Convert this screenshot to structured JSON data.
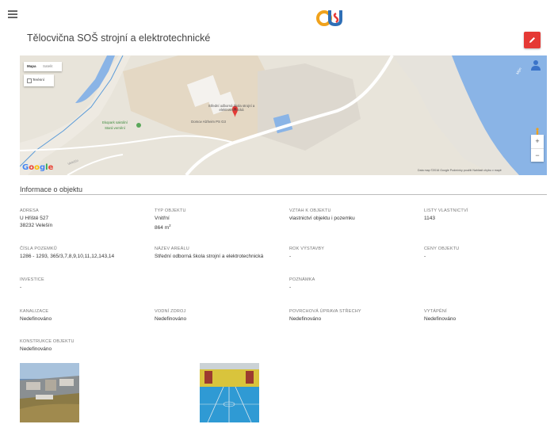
{
  "header": {
    "menu_icon": "hamburger-menu-icon",
    "logo_text": "CUS",
    "logo_colors": {
      "orange": "#f0a21c",
      "blue": "#2f6fb6",
      "red": "#e53935"
    }
  },
  "page": {
    "title": "Tělocvična SOŠ strojní a elektrotechnické",
    "edit_icon": "pencil-icon",
    "edit_color": "#e53935"
  },
  "map": {
    "type_map": "Mapa",
    "type_satellite": "Satelit",
    "terrain_label": "Terénní",
    "labels": [
      "Střední odborná škola strojní a elektrotechnická",
      "Domov Alzheim PS G3",
      "Ekopark sakrální",
      "Stará vernění",
      "Mlýn",
      "Velešín"
    ],
    "zoom_in": "+",
    "zoom_out": "−",
    "brand": "Google",
    "attribution": "Data map ©2016 Google   Podmínky použití   Nahlásit chybu v mapě"
  },
  "info": {
    "section_title": "Informace o objektu",
    "fields": {
      "adresa": {
        "label": "ADRESA",
        "lines": [
          "U Hřiště 527",
          "38232 Velešín"
        ]
      },
      "typ": {
        "label": "TYP OBJEKTU",
        "line1": "Vnitřní",
        "area_value": "864 m",
        "area_exp": "2"
      },
      "vztah": {
        "label": "VZTAH K OBJEKTU",
        "value": "vlastnictví objektu i pozemku"
      },
      "listy": {
        "label": "LISTY VLASTNICTVÍ",
        "value": "1143"
      },
      "cisla": {
        "label": "ČÍSLA POZEMKŮ",
        "value": "1286 - 1293, 365/3,7,8,9,10,11,12,143,14"
      },
      "nazev": {
        "label": "NÁZEV AREÁLU",
        "value": "Střední odborná škola strojní a elektrotechnická"
      },
      "rok": {
        "label": "ROK VÝSTAVBY",
        "value": "-"
      },
      "ceny": {
        "label": "CENY OBJEKTU",
        "value": "-"
      },
      "investice": {
        "label": "INVESTICE",
        "value": "-"
      },
      "poznamka": {
        "label": "POZNÁMKA",
        "value": "-"
      },
      "kanalizace": {
        "label": "KANALIZACE",
        "value": "Nedefinováno"
      },
      "vodni": {
        "label": "VODNÍ ZDROJ",
        "value": "Nedefinováno"
      },
      "povrch": {
        "label": "POVRCHOVÁ ÚPRAVA STŘECHY",
        "value": "Nedefinováno"
      },
      "vytapeni": {
        "label": "VYTÁPĚNÍ",
        "value": "Nedefinováno"
      },
      "konstrukce": {
        "label": "KONSTRUKCE OBJEKTU",
        "value": "Nedefinováno"
      }
    }
  },
  "photos": [
    {
      "name": "aerial-photo",
      "icon": "aerial-school-photo"
    },
    {
      "name": "gym-interior-photo",
      "icon": "gym-interior-photo"
    }
  ]
}
